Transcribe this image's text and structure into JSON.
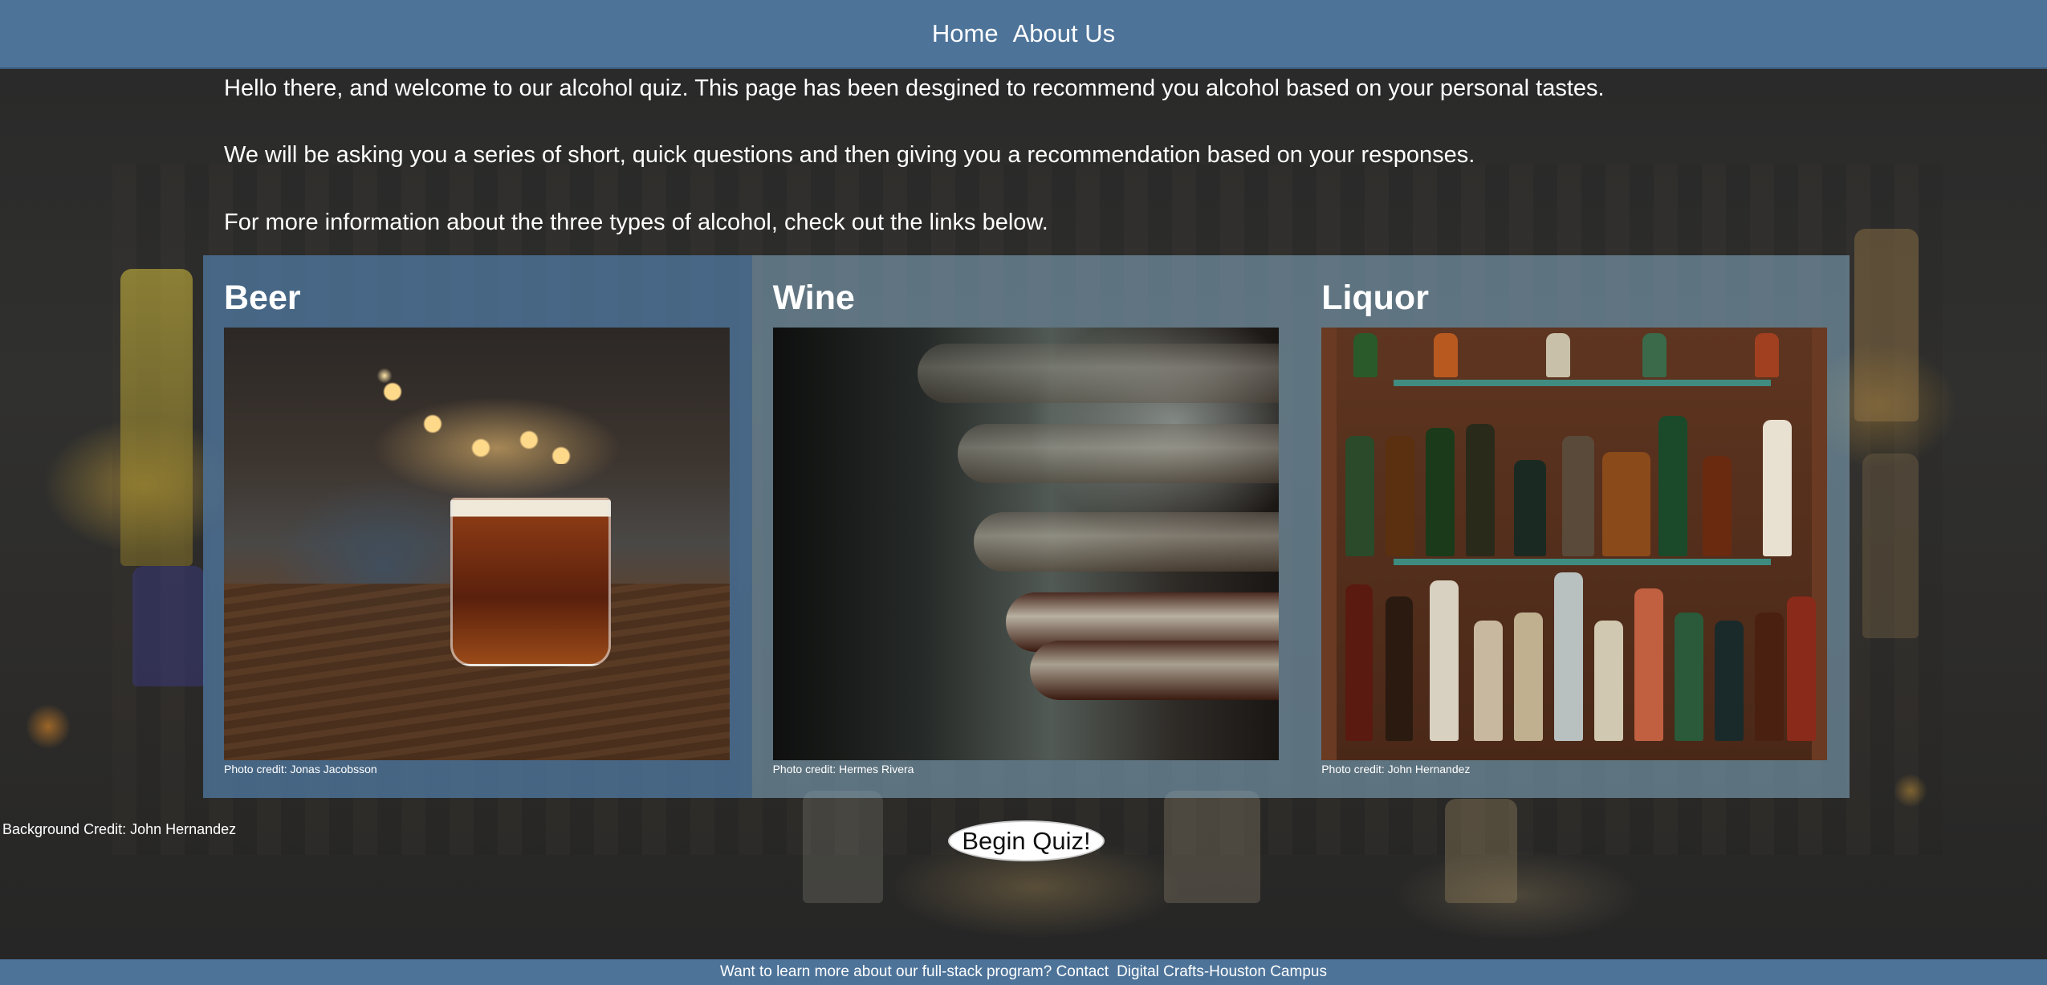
{
  "nav": {
    "links": [
      "Home",
      "About Us"
    ]
  },
  "intro": {
    "p1": "Hello there, and welcome to our alcohol quiz. This page has been desgined to recommend you alcohol based on your personal tastes.",
    "p2": "We will be asking you a series of short, quick questions and then giving you a recommendation based on your responses.",
    "p3": "For more information about the three types of alcohol, check out the links below."
  },
  "cards": [
    {
      "title": "Beer",
      "credit": "Photo credit: Jonas Jacobsson"
    },
    {
      "title": "Wine",
      "credit": "Photo credit: Hermes Rivera"
    },
    {
      "title": "Liquor",
      "credit": "Photo credit: John Hernandez"
    }
  ],
  "background_credit": "Background Credit: John Hernandez",
  "begin_button": "Begin Quiz!",
  "footer": {
    "text": "Want to learn more about our full-stack program? Contact",
    "link": "Digital Crafts-Houston Campus"
  },
  "colors": {
    "nav_bg": "#4d7399",
    "beer_card": "#4d7399",
    "wine_liquor_card": "#7ca0b4",
    "page_bg": "#222222"
  }
}
